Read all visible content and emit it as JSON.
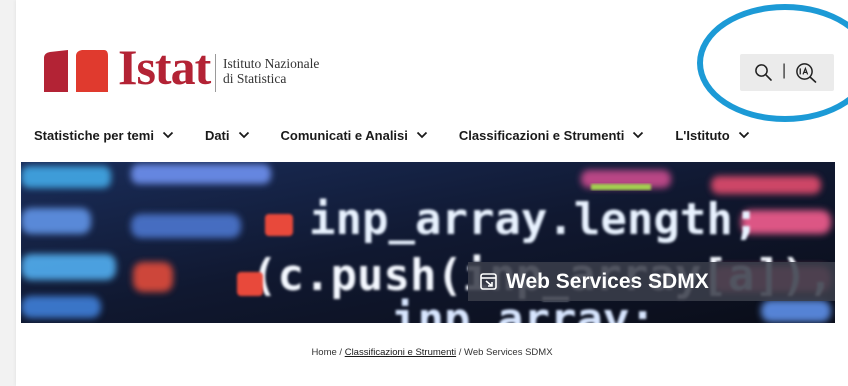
{
  "header": {
    "logo_word": "Istat",
    "logo_subtitle_line1": "Istituto Nazionale",
    "logo_subtitle_line2": "di Statistica",
    "tools": {
      "separator": "|",
      "search_icon": "search-icon",
      "ai_icon": "ia-icon"
    }
  },
  "nav": {
    "items": [
      {
        "label": "Statistiche per temi"
      },
      {
        "label": "Dati"
      },
      {
        "label": "Comunicati e Analisi"
      },
      {
        "label": "Classificazioni e Strumenti"
      },
      {
        "label": "L'Istituto"
      }
    ]
  },
  "banner": {
    "title": "Web Services SDMX",
    "code_text": {
      "line1": "inp_array.length;",
      "line2": "(c.push(inp_array[a]),",
      "line3": "inp_array;"
    }
  },
  "breadcrumb": {
    "home": "Home",
    "separator": "/",
    "section": "Classificazioni e Strumenti",
    "current": "Web Services SDMX"
  },
  "colors": {
    "brand_red": "#b32335",
    "brand_red_light": "#e03a2e",
    "highlight": "#1c9ad6",
    "banner_overlay": "#3a3e4a"
  }
}
